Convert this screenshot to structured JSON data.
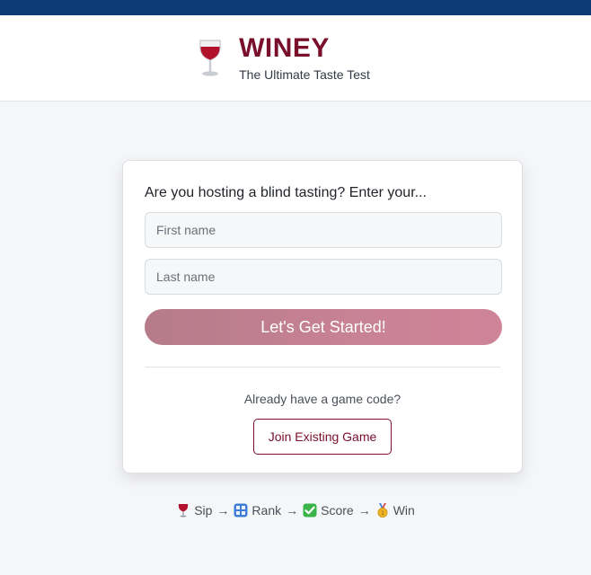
{
  "header": {
    "logo_icon": "wine-glass-icon",
    "title": "WINEY",
    "subtitle": "The Ultimate Taste Test"
  },
  "card": {
    "prompt": "Are you hosting a blind tasting? Enter your...",
    "first_name_placeholder": "First name",
    "first_name_value": "",
    "last_name_placeholder": "Last name",
    "last_name_value": "",
    "start_button": "Let's Get Started!",
    "already_text": "Already have a game code?",
    "join_button": "Join Existing Game"
  },
  "steps": [
    {
      "icon": "wine-glass-icon",
      "label": "Sip"
    },
    {
      "icon": "numbers-icon",
      "label": "Rank"
    },
    {
      "icon": "check-icon",
      "label": "Score"
    },
    {
      "icon": "medal-icon",
      "label": "Win"
    }
  ],
  "arrow": "→",
  "colors": {
    "top_strip": "#0f3a78",
    "brand": "#7a0f2c",
    "start_button": "#c88295"
  }
}
